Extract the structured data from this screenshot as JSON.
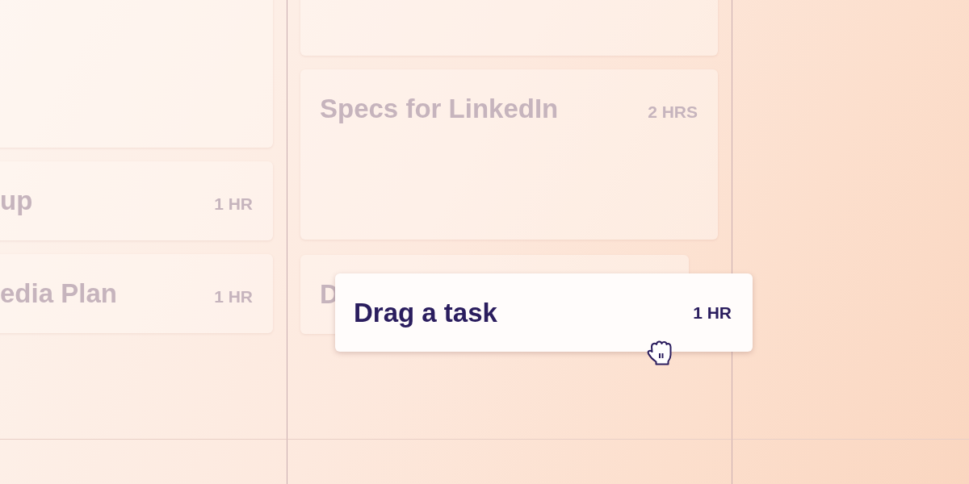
{
  "board": {
    "columns": [
      {
        "cards": [
          {
            "kind": "blank"
          },
          {
            "kind": "task",
            "title": "up",
            "duration": "1 HR"
          },
          {
            "kind": "task",
            "title": "edia Plan",
            "duration": "1 HR"
          }
        ]
      },
      {
        "cards": [
          {
            "kind": "blank"
          },
          {
            "kind": "task",
            "title": "Specs for LinkedIn",
            "duration": "2 HRS"
          },
          {
            "kind": "task",
            "title": "D"
          }
        ]
      }
    ]
  },
  "dragged_card": {
    "title": "Drag a task",
    "duration": "1 HR"
  }
}
